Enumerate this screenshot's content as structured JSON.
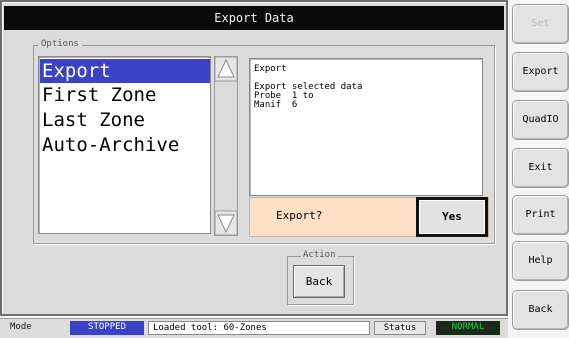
{
  "window": {
    "title": "Export Data"
  },
  "options": {
    "legend": "Options",
    "items": [
      {
        "label": "Export",
        "selected": true
      },
      {
        "label": "First Zone",
        "selected": false
      },
      {
        "label": "Last Zone",
        "selected": false
      },
      {
        "label": "Auto-Archive",
        "selected": false
      }
    ]
  },
  "info": {
    "text": "Export\n\nExport selected data\nProbe  1 to\nManif  6"
  },
  "confirm": {
    "prompt": "Export?",
    "yes_label": "Yes"
  },
  "action": {
    "legend": "Action",
    "back_label": "Back"
  },
  "sidebar": {
    "buttons": [
      {
        "label": "Set",
        "enabled": false
      },
      {
        "label": "Export",
        "enabled": true
      },
      {
        "label": "QuadIO",
        "enabled": true
      },
      {
        "label": "Exit",
        "enabled": true
      },
      {
        "label": "Print",
        "enabled": true
      },
      {
        "label": "Help",
        "enabled": true
      },
      {
        "label": "Back",
        "enabled": true
      }
    ]
  },
  "statusbar": {
    "mode_label": "Mode",
    "mode_value": "STOPPED",
    "tool_text": "Loaded tool: 60-Zones",
    "status_label": "Status",
    "status_value": "NORMAL"
  },
  "colors": {
    "selection": "#3a43c6",
    "title_bar": "#0a0a0a",
    "confirm_bg": "#fde0c6",
    "status_ok": "#2bd13b"
  }
}
